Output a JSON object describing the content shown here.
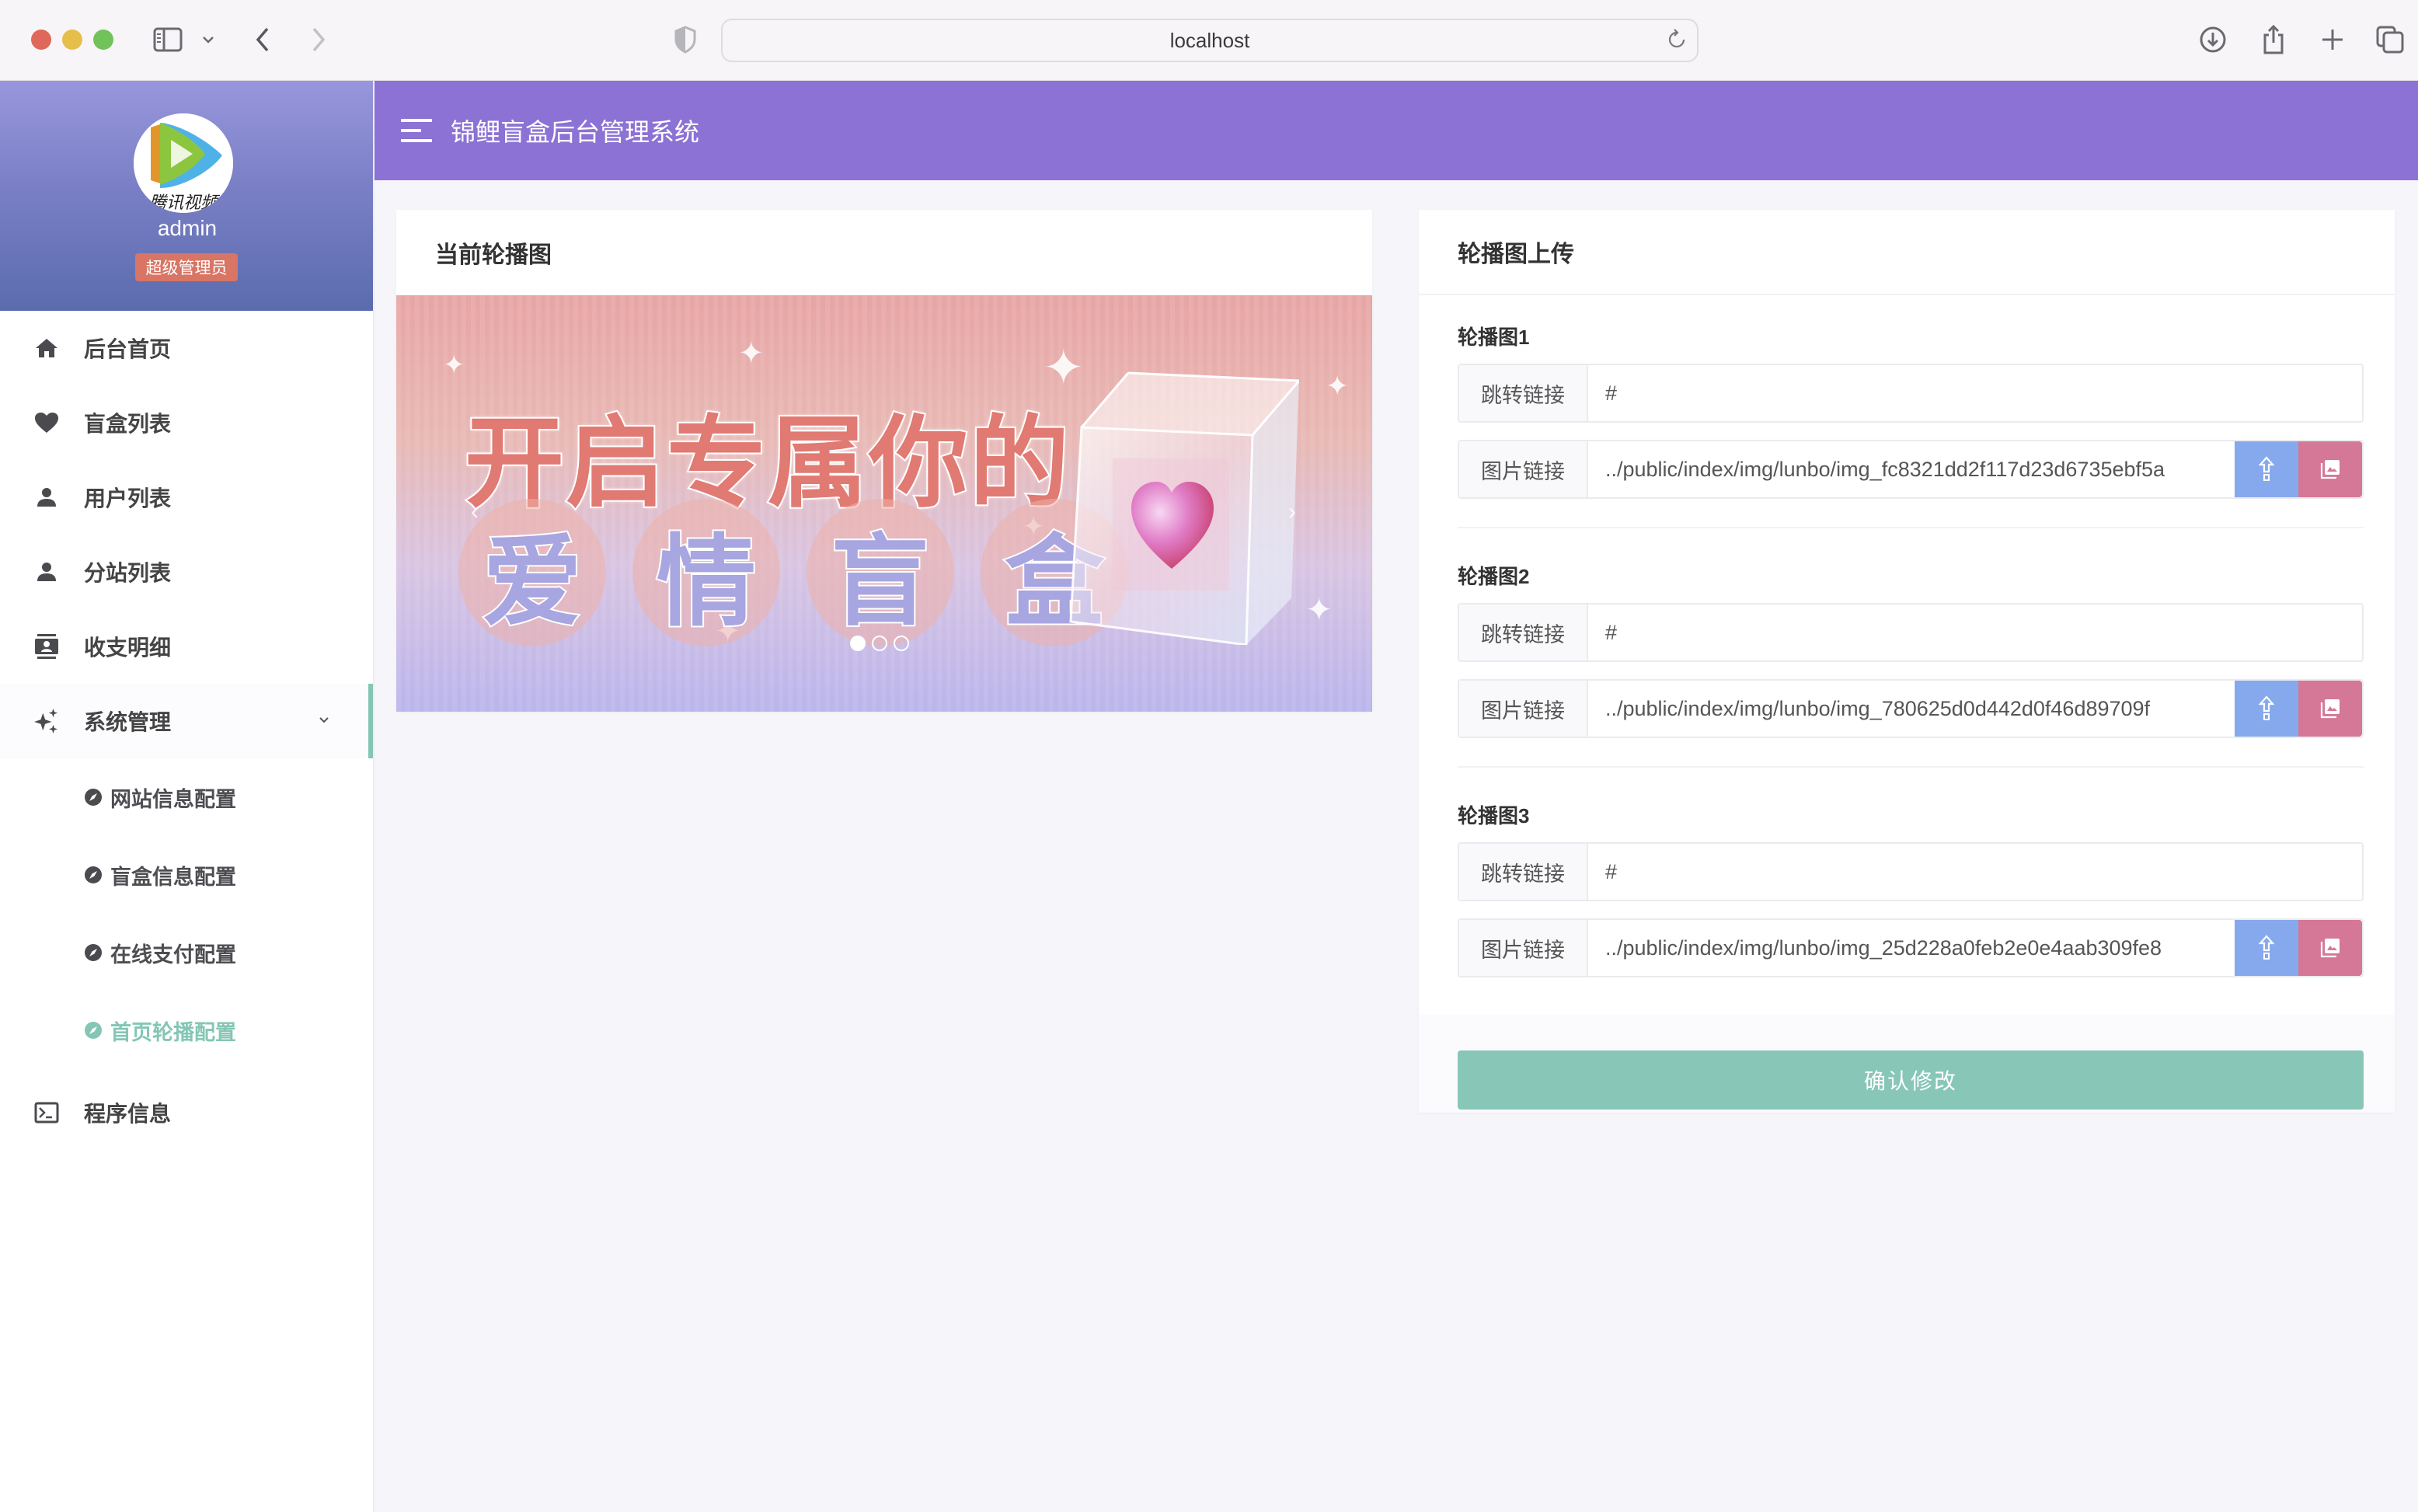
{
  "browser": {
    "url": "localhost",
    "icons": [
      "sidebar-toggle-icon",
      "chevron-down-icon",
      "back-icon",
      "forward-icon",
      "shield-icon",
      "reload-icon",
      "download-icon",
      "share-icon",
      "new-tab-icon",
      "tabs-overview-icon"
    ]
  },
  "app": {
    "title": "锦鲤盲盒后台管理系统"
  },
  "profile": {
    "avatar_caption": "腾讯视频",
    "username": "admin",
    "role": "超级管理员"
  },
  "sidebar": {
    "items": [
      {
        "label": "后台首页",
        "icon": "home-icon"
      },
      {
        "label": "盲盒列表",
        "icon": "heart-icon"
      },
      {
        "label": "用户列表",
        "icon": "user-icon"
      },
      {
        "label": "分站列表",
        "icon": "user-icon"
      },
      {
        "label": "收支明细",
        "icon": "contact-card-icon"
      },
      {
        "label": "系统管理",
        "icon": "sparkles-icon",
        "expanded": true
      }
    ],
    "sub_items": [
      {
        "label": "网站信息配置",
        "icon": "compass-icon"
      },
      {
        "label": "盲盒信息配置",
        "icon": "compass-icon"
      },
      {
        "label": "在线支付配置",
        "icon": "compass-icon"
      },
      {
        "label": "首页轮播配置",
        "icon": "compass-icon",
        "active": true
      }
    ],
    "bottom_items": [
      {
        "label": "程序信息",
        "icon": "terminal-icon"
      }
    ]
  },
  "current_carousel": {
    "title": "当前轮播图",
    "banner_line1": "开启专属你的",
    "banner_line2": [
      "爱",
      "情",
      "盲",
      "盒"
    ],
    "active_index": 0,
    "total_slides": 3
  },
  "upload": {
    "title": "轮播图上传",
    "link_label": "跳转链接",
    "image_label": "图片链接",
    "slides": [
      {
        "title": "轮播图1",
        "link": "#",
        "image": "../public/index/img/lunbo/img_fc8321dd2f117d23d6735ebf5a"
      },
      {
        "title": "轮播图2",
        "link": "#",
        "image": "../public/index/img/lunbo/img_780625d0d442d0f46d89709f"
      },
      {
        "title": "轮播图3",
        "link": "#",
        "image": "../public/index/img/lunbo/img_25d228a0feb2e0e4aab309fe8"
      }
    ],
    "confirm_label": "确认修改"
  },
  "colors": {
    "header": "#8b72d4",
    "accent": "#84c6b4",
    "upload_button": "#86a9ee",
    "gallery_button": "#d57796",
    "role_badge": "#d87564"
  }
}
